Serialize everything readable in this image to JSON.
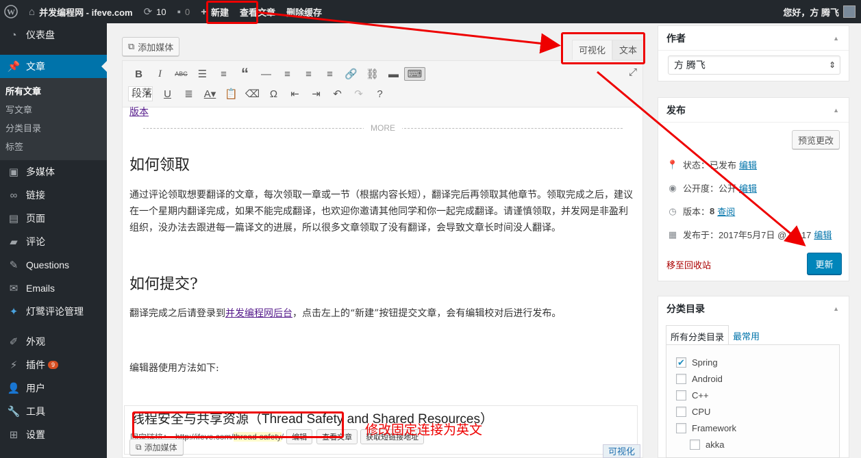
{
  "adminbar": {
    "site_name": "并发编程网 - ifeve.com",
    "updates_count": "10",
    "comments_count": "0",
    "new_label": "新建",
    "view_post": "查看文章",
    "clear_cache": "删除缓存",
    "greeting": "您好，方 腾飞"
  },
  "menu": {
    "dashboard": "仪表盘",
    "posts": "文章",
    "sub_all_posts": "所有文章",
    "sub_write": "写文章",
    "sub_categories": "分类目录",
    "sub_tags": "标签",
    "media": "多媒体",
    "links": "链接",
    "pages": "页面",
    "comments": "评论",
    "questions": "Questions",
    "emails": "Emails",
    "comment_mgmt": "灯鹭评论管理",
    "appearance": "外观",
    "plugins": "插件",
    "plugins_badge": "9",
    "users": "用户",
    "tools": "工具",
    "settings": "设置"
  },
  "editor": {
    "add_media": "添加媒体",
    "tab_visual": "可视化",
    "tab_text": "文本",
    "format_select": "段落",
    "clipped_link": "版本",
    "more_label": "MORE",
    "heading1": "如何领取",
    "para1": "通过评论领取想要翻译的文章，每次领取一章或一节（根据内容长短），翻译完后再领取其他章节。领取完成之后，建议在一个星期内翻译完成，如果不能完成翻译，也欢迎你邀请其他同学和你一起完成翻译。请谨慎领取，并发网是非盈利组织，没办法去跟进每一篇译文的进展，所以很多文章领取了没有翻译，会导致文章长时间没人翻译。",
    "heading2": "如何提交?",
    "para2_before": "翻译完成之后请登录到",
    "para2_link": "并发编程网后台",
    "para2_after": "，点击左上的“新建”按钮提交文章，会有编辑校对后进行发布。",
    "para3": "编辑器使用方法如下:",
    "embed_title": "线程安全与共享资源（Thread Safety and Shared Resources）",
    "permalink_label": "固定链接：",
    "permalink_base": "http://ifeve.com/",
    "permalink_slug": "thread-safety",
    "permalink_end": "/",
    "edit_btn": "编辑",
    "view_btn": "查看文章",
    "short_btn": "获取短链接地址",
    "embed_add_media": "添加媒体",
    "embed_visual": "可视化"
  },
  "author_box": {
    "title": "作者",
    "selected": "方 腾飞"
  },
  "publish_box": {
    "title": "发布",
    "preview": "预览更改",
    "status_label": "状态：",
    "status_value": "已发布",
    "visibility_label": "公开度：",
    "visibility_value": "公开",
    "revisions_label": "版本：",
    "revisions_value": "8",
    "browse": "查阅",
    "published_label": "发布于：",
    "published_value": "2017年5月7日 @ 15:17",
    "edit": "编辑",
    "trash": "移至回收站",
    "update": "更新"
  },
  "category_box": {
    "title": "分类目录",
    "tab_all": "所有分类目录",
    "tab_popular": "最常用",
    "items": [
      {
        "label": "Spring",
        "checked": true
      },
      {
        "label": "Android",
        "checked": false
      },
      {
        "label": "C++",
        "checked": false
      },
      {
        "label": "CPU",
        "checked": false
      },
      {
        "label": "Framework",
        "checked": false
      },
      {
        "label": "akka",
        "checked": false
      }
    ]
  },
  "annotation": "修改固定连接为英文",
  "colors": {
    "adminbar": "#23282d",
    "menu_active": "#0073aa",
    "annotation_red": "#e00000",
    "primary_button": "#0085ba"
  }
}
